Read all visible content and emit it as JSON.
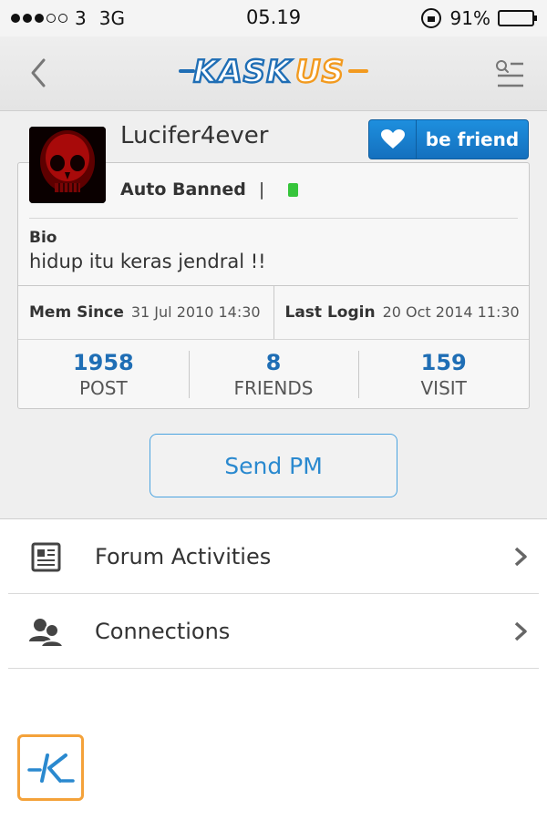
{
  "status_bar": {
    "carrier": "3",
    "network": "3G",
    "time": "05.19",
    "battery": "91%",
    "battery_level": 0.91,
    "signal_bars": 3
  },
  "nav": {
    "logo": "KASKUS",
    "back_icon": "chevron-left-icon",
    "menu_icon": "search-menu-icon"
  },
  "profile": {
    "username": "Lucifer4ever",
    "befriend_label": "be friend",
    "status": "Auto Banned",
    "separator": "|",
    "online_color": "#36c53b",
    "bio_label": "Bio",
    "bio_text": "hidup itu keras jendral !!",
    "mem_since_label": "Mem Since",
    "mem_since_value": "31 Jul 2010 14:30",
    "last_login_label": "Last Login",
    "last_login_value": "20 Oct 2014 11:30",
    "stats": [
      {
        "value": "1958",
        "label": "POST"
      },
      {
        "value": "8",
        "label": "FRIENDS"
      },
      {
        "value": "159",
        "label": "VISIT"
      }
    ],
    "send_pm_label": "Send PM"
  },
  "menu": {
    "items": [
      {
        "label": "Forum Activities",
        "icon": "newspaper-icon"
      },
      {
        "label": "Connections",
        "icon": "people-icon"
      }
    ]
  },
  "colors": {
    "accent_blue": "#1f6eb5",
    "brand_orange": "#f29a1f"
  }
}
